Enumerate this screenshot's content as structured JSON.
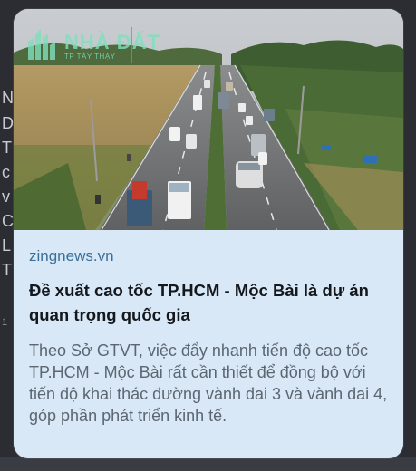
{
  "card": {
    "source": "zingnews.vn",
    "headline": "Đề xuất cao tốc TP.HCM - Mộc Bài là dự án quan trọng quốc gia",
    "summary": "Theo Sở GTVT, việc đẩy nhanh tiến độ cao tốc TP.HCM - Mộc Bài rất cần thiết để đồng bộ với tiến độ khai thác đường vành đai 3 và vành đai 4, góp phần phát triển kinh tế.",
    "watermark": {
      "title": "NHÀ ĐẤT",
      "subtitle": "TP TÂY THẠY"
    }
  },
  "background_hints": [
    "N",
    "D",
    "T",
    "c",
    "v",
    "C",
    "L",
    "T"
  ],
  "background_meta": "1",
  "colors": {
    "card_bg": "#d9e8f6",
    "source": "#3b6f99",
    "headline": "#14181d",
    "summary": "#5b6670",
    "page_bg": "#2b2d33"
  }
}
